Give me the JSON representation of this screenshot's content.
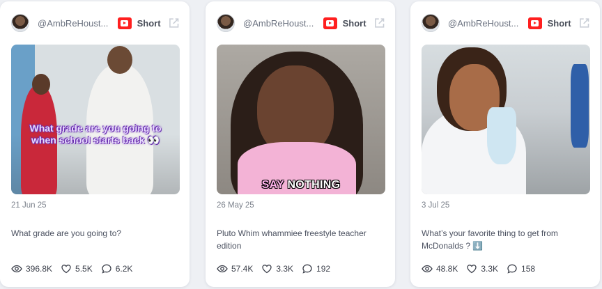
{
  "cards": [
    {
      "handle": "@AmbReHoust...",
      "type_label": "Short",
      "overlay_text": "What grade are you going to when school starts back 👀",
      "date": "21 Jun 25",
      "description": "What grade are you going to?",
      "views": "396.8K",
      "likes": "5.5K",
      "comments": "6.2K"
    },
    {
      "handle": "@AmbReHoust...",
      "type_label": "Short",
      "overlay_word_1": "SAY",
      "overlay_word_2": "NOTHING",
      "date": "26 May 25",
      "description": "Pluto Whim whammiee freestyle teacher edition",
      "views": "57.4K",
      "likes": "3.3K",
      "comments": "192"
    },
    {
      "handle": "@AmbReHoust...",
      "type_label": "Short",
      "date": "3 Jul 25",
      "description": "What’s your favorite thing to get from McDonalds ? ⬇️",
      "views": "48.8K",
      "likes": "3.3K",
      "comments": "158"
    }
  ],
  "colors": {
    "youtube_red": "#ff1f1f",
    "card_bg": "#ffffff",
    "page_bg": "#eef0f4"
  },
  "icons": {
    "platform": "youtube-icon",
    "external": "external-link-icon",
    "views": "eye-icon",
    "likes": "heart-icon",
    "comments": "comment-icon"
  }
}
